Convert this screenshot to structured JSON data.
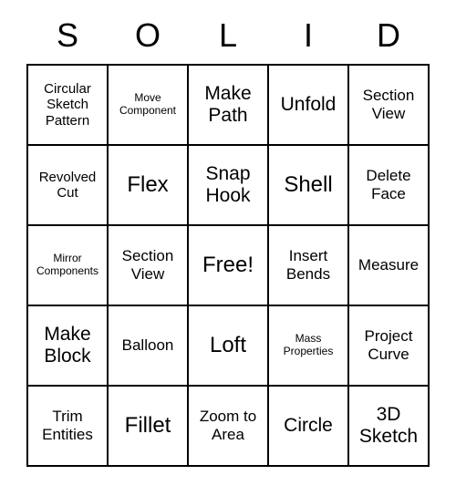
{
  "header": {
    "letters": [
      "S",
      "O",
      "L",
      "I",
      "D"
    ]
  },
  "grid": {
    "rows": [
      [
        {
          "text": "Circular Sketch Pattern",
          "size": "sm"
        },
        {
          "text": "Move Component",
          "size": "xs"
        },
        {
          "text": "Make Path",
          "size": "lg"
        },
        {
          "text": "Unfold",
          "size": "lg"
        },
        {
          "text": "Section View",
          "size": "md"
        }
      ],
      [
        {
          "text": "Revolved Cut",
          "size": "sm"
        },
        {
          "text": "Flex",
          "size": "xl"
        },
        {
          "text": "Snap Hook",
          "size": "lg"
        },
        {
          "text": "Shell",
          "size": "xl"
        },
        {
          "text": "Delete Face",
          "size": "md"
        }
      ],
      [
        {
          "text": "Mirror Components",
          "size": "xs"
        },
        {
          "text": "Section View",
          "size": "md"
        },
        {
          "text": "Free!",
          "size": "xl"
        },
        {
          "text": "Insert Bends",
          "size": "md"
        },
        {
          "text": "Measure",
          "size": "md"
        }
      ],
      [
        {
          "text": "Make Block",
          "size": "lg"
        },
        {
          "text": "Balloon",
          "size": "md"
        },
        {
          "text": "Loft",
          "size": "xl"
        },
        {
          "text": "Mass Properties",
          "size": "xs"
        },
        {
          "text": "Project Curve",
          "size": "md"
        }
      ],
      [
        {
          "text": "Trim Entities",
          "size": "md"
        },
        {
          "text": "Fillet",
          "size": "xl"
        },
        {
          "text": "Zoom to Area",
          "size": "md"
        },
        {
          "text": "Circle",
          "size": "lg"
        },
        {
          "text": "3D Sketch",
          "size": "lg"
        }
      ]
    ]
  }
}
